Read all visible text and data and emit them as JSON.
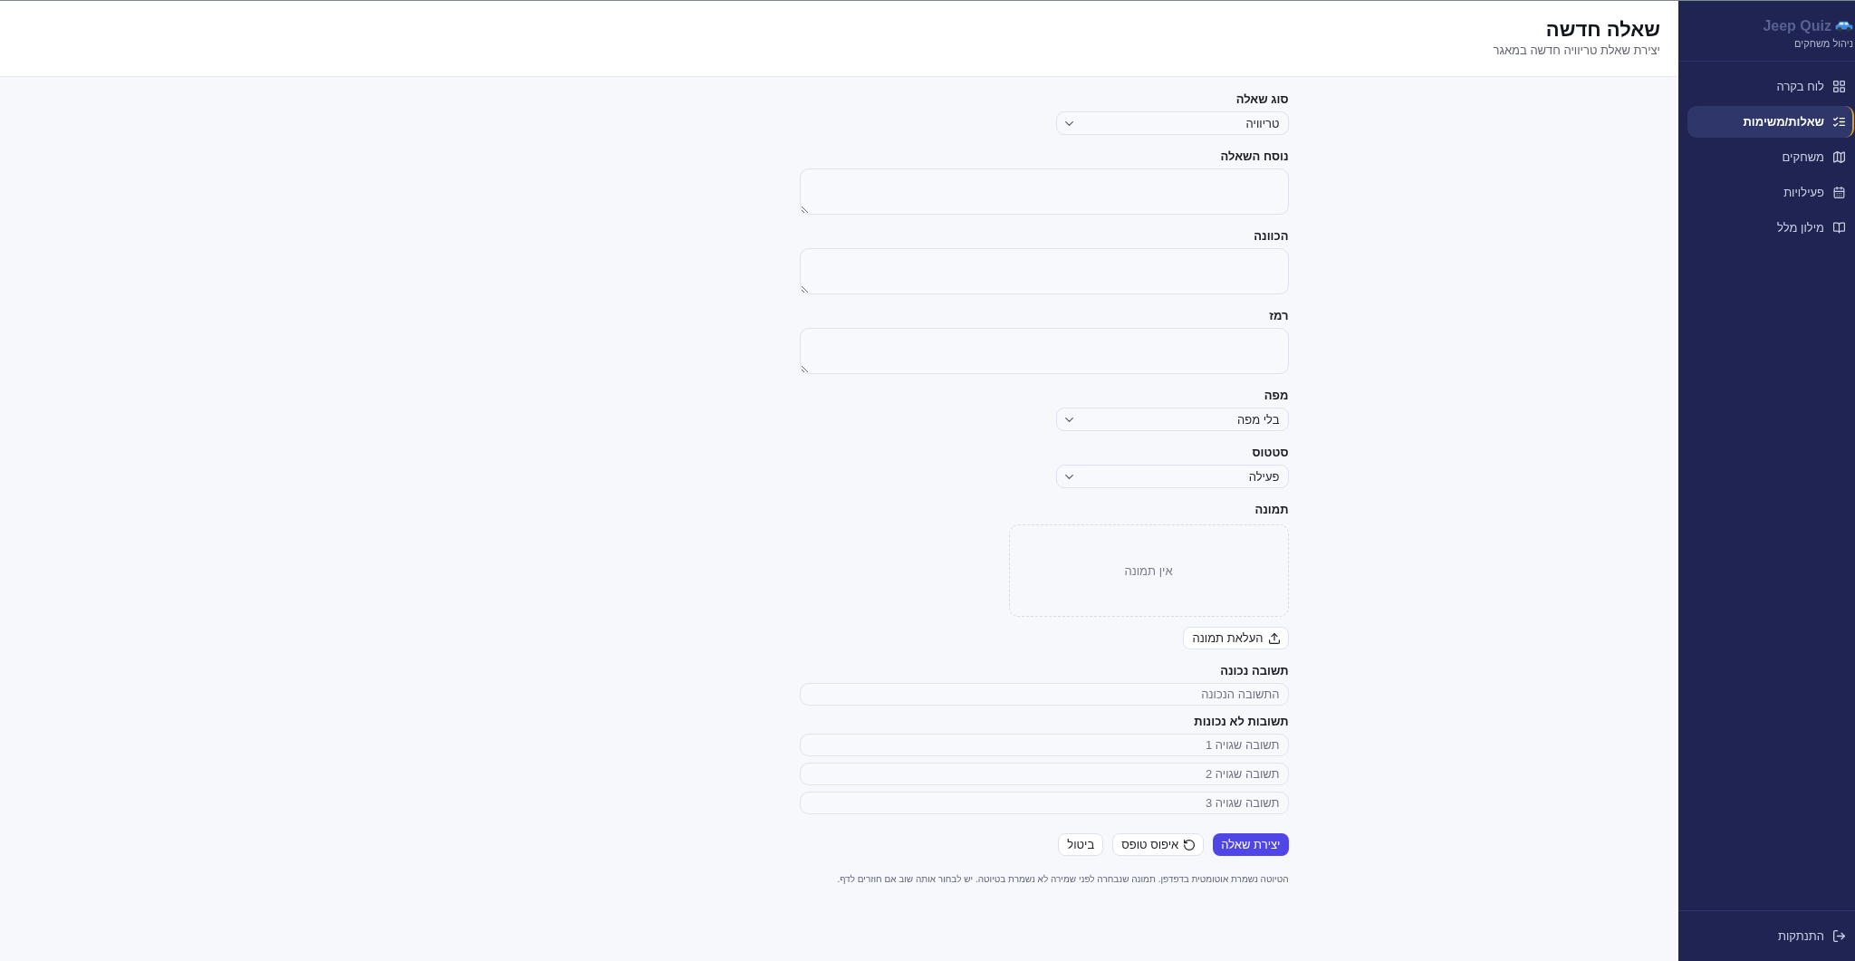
{
  "sidebar": {
    "brand": {
      "title": "Jeep Quiz",
      "subtitle": "ניהול משחקים"
    },
    "items": [
      {
        "label": "לוח בקרה",
        "selected": false
      },
      {
        "label": "שאלות/משימות",
        "selected": true
      },
      {
        "label": "משחקים",
        "selected": false
      },
      {
        "label": "פעילויות",
        "selected": false
      },
      {
        "label": "מילון מלל",
        "selected": false
      }
    ],
    "logout": "התנתקות"
  },
  "header": {
    "title": "שאלה חדשה",
    "subtitle": "יצירת שאלת טריוויה חדשה במאגר"
  },
  "form": {
    "fields": [
      {
        "kind": "select",
        "label": "סוג שאלה",
        "value": "טריוויה"
      },
      {
        "kind": "textarea",
        "label": "נוסח השאלה"
      },
      {
        "kind": "textarea",
        "label": "הכוונה"
      },
      {
        "kind": "textarea",
        "label": "רמז"
      },
      {
        "kind": "select",
        "label": "מפה",
        "value": "בלי מפה"
      },
      {
        "kind": "select",
        "label": "סטטוס",
        "value": "פעילה"
      },
      {
        "kind": "image",
        "label": "תמונה",
        "empty_text": "אין תמונה",
        "upload_button": "העלאת תמונה"
      },
      {
        "kind": "inputs",
        "label": "תשובה נכונה",
        "inputs": [
          {
            "placeholder": "התשובה הנכונה"
          }
        ]
      },
      {
        "kind": "inputs",
        "label": "תשובות לא נכונות",
        "inputs": [
          {
            "placeholder": "תשובה שגויה 1"
          },
          {
            "placeholder": "תשובה שגויה 2"
          },
          {
            "placeholder": "תשובה שגויה 3"
          }
        ]
      }
    ],
    "buttons": [
      {
        "kind": "primary",
        "label": "יצירת שאלה"
      },
      {
        "kind": "reset",
        "label": "איפוס טופס"
      },
      {
        "kind": "plain",
        "label": "ביטול"
      }
    ],
    "note": "הטיוטה נשמרת אוטומטית בדפדפן. תמונה שנבחרה לפני שמירה לא נשמרת בטיוטה. יש לבחור אותה שוב אם חוזרים לדף."
  }
}
